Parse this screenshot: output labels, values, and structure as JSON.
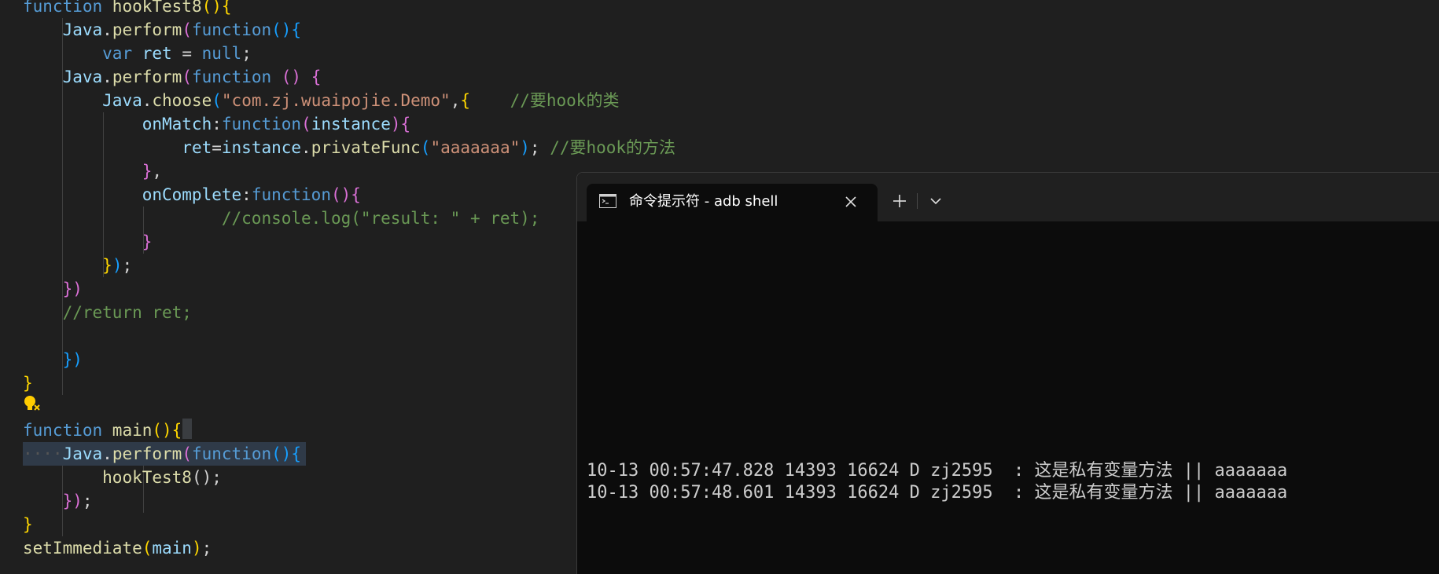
{
  "editor": {
    "lines": [
      [
        {
          "t": "function ",
          "c": "kw"
        },
        {
          "t": "hookTest8",
          "c": "fn"
        },
        {
          "t": "(){",
          "c": "b1"
        }
      ],
      [
        {
          "t": "    "
        },
        {
          "t": "Java",
          "c": "var"
        },
        {
          "t": "."
        },
        {
          "t": "perform",
          "c": "fn"
        },
        {
          "t": "(",
          "c": "b2"
        },
        {
          "t": "function",
          "c": "kw"
        },
        {
          "t": "(){",
          "c": "b3"
        }
      ],
      [
        {
          "t": "        "
        },
        {
          "t": "var ",
          "c": "kw"
        },
        {
          "t": "ret",
          "c": "var"
        },
        {
          "t": " = "
        },
        {
          "t": "null",
          "c": "kw"
        },
        {
          "t": ";"
        }
      ],
      [
        {
          "t": "    "
        },
        {
          "t": "Java",
          "c": "var"
        },
        {
          "t": "."
        },
        {
          "t": "perform",
          "c": "fn"
        },
        {
          "t": "(",
          "c": "b2"
        },
        {
          "t": "function ",
          "c": "kw"
        },
        {
          "t": "() {",
          "c": "b2"
        }
      ],
      [
        {
          "t": "        "
        },
        {
          "t": "Java",
          "c": "var"
        },
        {
          "t": "."
        },
        {
          "t": "choose",
          "c": "fn"
        },
        {
          "t": "(",
          "c": "b3"
        },
        {
          "t": "\"com.zj.wuaipojie.Demo\"",
          "c": "str"
        },
        {
          "t": ","
        },
        {
          "t": "{",
          "c": "b1"
        },
        {
          "t": "    "
        },
        {
          "t": "//要hook的类",
          "c": "cm"
        }
      ],
      [
        {
          "t": "            "
        },
        {
          "t": "onMatch",
          "c": "var"
        },
        {
          "t": ":"
        },
        {
          "t": "function",
          "c": "kw"
        },
        {
          "t": "(",
          "c": "b2"
        },
        {
          "t": "instance",
          "c": "var"
        },
        {
          "t": "){",
          "c": "b2"
        }
      ],
      [
        {
          "t": "                "
        },
        {
          "t": "ret",
          "c": "var"
        },
        {
          "t": "="
        },
        {
          "t": "instance",
          "c": "var"
        },
        {
          "t": "."
        },
        {
          "t": "privateFunc",
          "c": "fn"
        },
        {
          "t": "(",
          "c": "b3"
        },
        {
          "t": "\"aaaaaaa\"",
          "c": "str"
        },
        {
          "t": ")",
          "c": "b3"
        },
        {
          "t": "; "
        },
        {
          "t": "//要hook的方法",
          "c": "cm"
        }
      ],
      [
        {
          "t": "            "
        },
        {
          "t": "}",
          "c": "b2"
        },
        {
          "t": ","
        }
      ],
      [
        {
          "t": "            "
        },
        {
          "t": "onComplete",
          "c": "var"
        },
        {
          "t": ":"
        },
        {
          "t": "function",
          "c": "kw"
        },
        {
          "t": "(){",
          "c": "b2"
        }
      ],
      [
        {
          "t": "                    "
        },
        {
          "t": "//console.log(\"result: \" + ret);",
          "c": "cm"
        }
      ],
      [
        {
          "t": "            "
        },
        {
          "t": "}",
          "c": "b2"
        }
      ],
      [
        {
          "t": "        "
        },
        {
          "t": "}",
          "c": "b1"
        },
        {
          "t": ")",
          "c": "b3"
        },
        {
          "t": ";"
        }
      ],
      [
        {
          "t": "    "
        },
        {
          "t": "})",
          "c": "b2"
        }
      ],
      [
        {
          "t": "    "
        },
        {
          "t": "//return ret;",
          "c": "cm"
        }
      ],
      [
        {
          "t": ""
        }
      ],
      [
        {
          "t": "    "
        },
        {
          "t": "})",
          "c": "b3"
        }
      ],
      [
        {
          "t": "}",
          "c": "b1"
        }
      ],
      [
        {
          "t": ""
        }
      ],
      [
        {
          "t": "function ",
          "c": "kw"
        },
        {
          "t": "main",
          "c": "fn"
        },
        {
          "t": "(){",
          "c": "b1"
        }
      ],
      [
        {
          "t": "····",
          "c": "ws-dots"
        },
        {
          "t": "Java",
          "c": "var"
        },
        {
          "t": "."
        },
        {
          "t": "perform",
          "c": "fn"
        },
        {
          "t": "(",
          "c": "b2"
        },
        {
          "t": "function",
          "c": "kw"
        },
        {
          "t": "(){",
          "c": "b3"
        }
      ],
      [
        {
          "t": "        "
        },
        {
          "t": "hookTest8",
          "c": "fn"
        },
        {
          "t": "();"
        }
      ],
      [
        {
          "t": "    "
        },
        {
          "t": "})",
          "c": "b2"
        },
        {
          "t": ";"
        }
      ],
      [
        {
          "t": "}",
          "c": "b1"
        }
      ],
      [
        {
          "t": "setImmediate",
          "c": "fn"
        },
        {
          "t": "(",
          "c": "b1"
        },
        {
          "t": "main",
          "c": "var"
        },
        {
          "t": ")",
          "c": "b1"
        },
        {
          "t": ";"
        }
      ]
    ]
  },
  "terminal": {
    "tab_title": "命令提示符 - adb  shell",
    "new_tab_icon": "plus-icon",
    "dropdown_icon": "chevron-down-icon",
    "close_icon": "close-icon",
    "output": [
      "10-13 00:57:47.828 14393 16624 D zj2595  : 这是私有变量方法 || aaaaaaa",
      "10-13 00:57:48.601 14393 16624 D zj2595  : 这是私有变量方法 || aaaaaaa"
    ]
  }
}
